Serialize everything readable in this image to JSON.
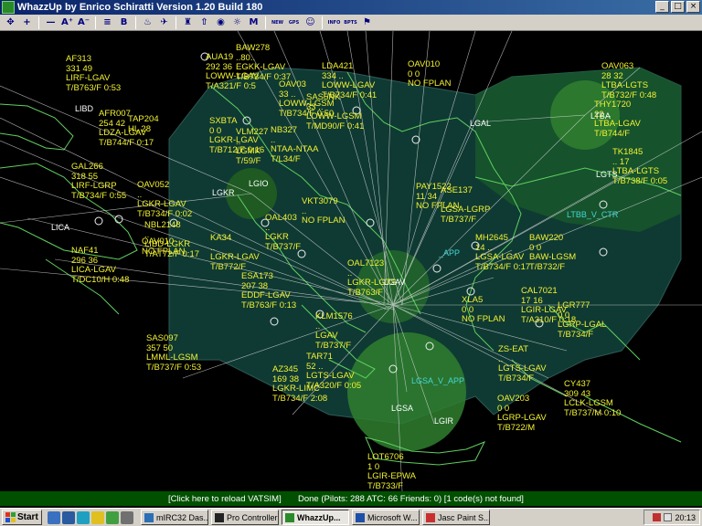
{
  "window": {
    "title": "WhazzUp by Enrico Schiratti Version 1.20 Build 180",
    "minimize": "_",
    "maximize": "□",
    "close": "×"
  },
  "toolbar": [
    {
      "name": "pan-icon",
      "glyph": "✥"
    },
    {
      "name": "zoom-in-button",
      "glyph": "+"
    },
    {
      "name": "zoom-out-button",
      "glyph": "—"
    },
    {
      "name": "font-larger-button",
      "glyph": "A⁺"
    },
    {
      "name": "font-smaller-button",
      "glyph": "A⁻"
    },
    {
      "name": "text-options-button",
      "glyph": "≡"
    },
    {
      "name": "bold-text-button",
      "glyph": "B"
    },
    {
      "name": "lamp-icon",
      "glyph": "♨"
    },
    {
      "name": "aircraft-button",
      "glyph": "✈"
    },
    {
      "name": "tower-button",
      "glyph": "♜"
    },
    {
      "name": "hold-button",
      "glyph": "⇧"
    },
    {
      "name": "ndb-vor-button",
      "glyph": "◉"
    },
    {
      "name": "filter-button",
      "glyph": "☼"
    },
    {
      "name": "metar-button",
      "glyph": "M"
    },
    {
      "name": "new-button",
      "glyph": "NEW"
    },
    {
      "name": "gps-button",
      "glyph": "GPS"
    },
    {
      "name": "friends-smiley-icon",
      "glyph": "☺"
    },
    {
      "name": "info-button",
      "glyph": "INFO"
    },
    {
      "name": "bpts-button",
      "glyph": "BPTS"
    },
    {
      "name": "flag-button",
      "glyph": "⚑"
    }
  ],
  "airports": [
    {
      "code": "LIBD"
    },
    {
      "code": "LGAL"
    },
    {
      "code": "LTBA"
    },
    {
      "code": "LGTS"
    },
    {
      "code": "LGKR"
    },
    {
      "code": "LGIO"
    },
    {
      "code": "LICA"
    },
    {
      "code": "LGAV"
    },
    {
      "code": "LGSA"
    },
    {
      "code": "LGIR"
    }
  ],
  "sectors": [
    {
      "label": "LTBB_V_CTR"
    },
    {
      "label": "LGSA_V_APP"
    },
    {
      "label": "_APP"
    }
  ],
  "flights": [
    {
      "label": "AF313\n331 49\nLIRF-LGAV\nT/B763/F 0:53"
    },
    {
      "label": "AFR007\n254 42\nLDZA-LGAV\nT/B744/F 0:17"
    },
    {
      "label": "TAP204\nHL 28"
    },
    {
      "label": "AUA19\n292 36\nLOWW-LGAV\nT/A321/F 0:5"
    },
    {
      "label": "BAW278\n..80..\nEGKK-LGAV\nT/B734/F 0:37"
    },
    {
      "label": "OAV03\n33 ..\nLOWW-LGSM\nT/B734/F 0:50"
    },
    {
      "label": "LDA421\n334 ..\nLOWW-LGAV\nT/B734/F 0:41"
    },
    {
      "label": "SAS5NK\n33 ..\nLOWW-LGSM\nT/MD90/F 0:41"
    },
    {
      "label": "OAV010\n0 0\nNO FPLAN"
    },
    {
      "label": "OAV063\n28 32\nLTBA-LGTS\nT/B732/F 0:48"
    },
    {
      "label": "THY1720\n22 ..\nLTBA-LGAV\nT/B744/F"
    },
    {
      "label": "TK1845\n.. 17\nLTBA-LGTS\nT/B738/F 0:05"
    },
    {
      "label": "SXBTA\n0 0\nLGKR-LGAV\nT/B712/F 0:16"
    },
    {
      "label": "VLM227\n..\nLGMK\nT/59/F"
    },
    {
      "label": "NB327\n..\nNTAA-NTAA\nT/L34/F"
    },
    {
      "label": "GAL266\n318 55\nLIRF-LGRP\nT/B734/F 0:55"
    },
    {
      "label": "OAV052\n..\nLGKR-LGAV\nT/B734/F 0:02"
    },
    {
      "label": "NBL2148\n..\nLIBD-LGKR\nT/AT72/F 0:17"
    },
    {
      "label": "OAV010\nNO FPLAN"
    },
    {
      "label": "NAF41\n296 36\nLICA-LGAV\nT/DC10/H 0:48"
    },
    {
      "label": "KA34\n..\nLGKR-LGAV\nT/B772/F"
    },
    {
      "label": "OAL403\n..\nLGKR\nT/B737/F"
    },
    {
      "label": "ESA173\n207 38\nEDDF-LGAV\nT/B763/F 0:13"
    },
    {
      "label": "VKT3079\n..\nNO FPLAN"
    },
    {
      "label": "PAY1522\n11 34\nNO FPLAN"
    },
    {
      "label": "ASE137\n..\nLGSA-LGRP\nT/B737/F"
    },
    {
      "label": "MH2645\n14 ..\nLGSA-LGAV\nT/B734/F 0:17"
    },
    {
      "label": "BAW220\n0 0\nBAW-LGSM\nT/B732/F"
    },
    {
      "label": "CAL7021\n17 16\nLGIR-LGAV\nT/A310/F 0:18"
    },
    {
      "label": "LGR777\n0 0\nLGRP-LGAL\nT/B734/F"
    },
    {
      "label": "SAS097\n357 50\nLMML-LGSM\nT/B737/F 0:53"
    },
    {
      "label": "KLM1576\n..\nLGAV\nT/B737/F"
    },
    {
      "label": "AZ345\n169 38\nLGKR-LIMC\nT/B734/F 2:08"
    },
    {
      "label": "TAR71\n52 ..\nLGTS-LGAV\nT/A320/F 0:05"
    },
    {
      "label": "OAV203\n0 0\nLGRP-LGAV\nT/B722/M"
    },
    {
      "label": "CY437\n309 43\nLCLK-LGSM\nT/B737/M 0:10"
    },
    {
      "label": "LOT6706\n1 0\nLGIR-EPWA\nT/B733/F"
    },
    {
      "label": "OAL7123\n..\nLGKR-LGTS\nT/B763/F"
    },
    {
      "label": "ZS-EAT\n..\nLGTS-LGAV\nT/B734/F"
    },
    {
      "label": "XLA5\n0 0\nNO FPLAN"
    }
  ],
  "statusbar": {
    "reload": "[Click here to reload VATSIM]",
    "done": "Done  (Pilots: 288  ATC: 66  Friends: 0)  [1 code(s) not found]"
  },
  "taskbar": {
    "start": "Start",
    "tasks": [
      {
        "label": "mIRC32 Das...",
        "color": "#2b6fb5",
        "active": false
      },
      {
        "label": "Pro Controller",
        "color": "#222",
        "active": false
      },
      {
        "label": "WhazzUp...",
        "color": "#2a8a2a",
        "active": true
      },
      {
        "label": "Microsoft W...",
        "color": "#1d4fa8",
        "active": false
      },
      {
        "label": "Jasc Paint S...",
        "color": "#c83030",
        "active": false
      }
    ],
    "clock": "20:13"
  }
}
